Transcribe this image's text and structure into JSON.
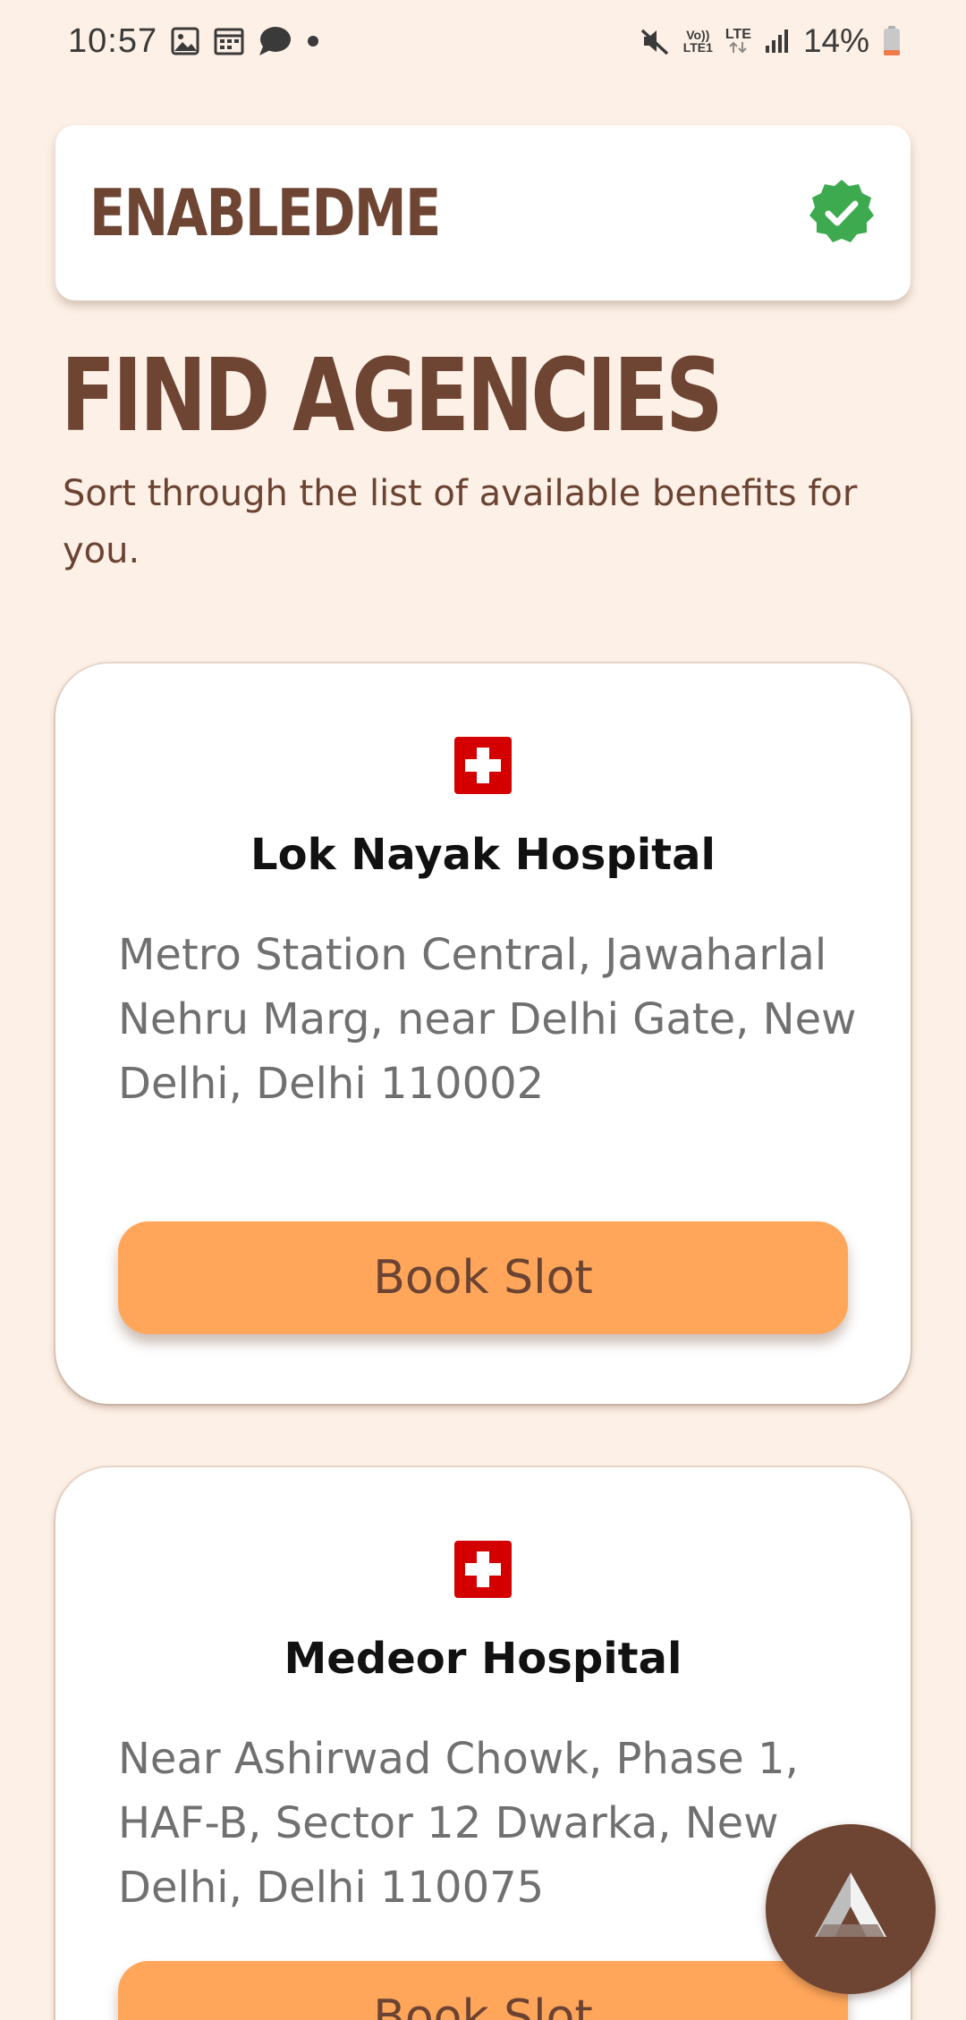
{
  "status_bar": {
    "time": "10:57",
    "notification_icons": [
      "gallery-icon",
      "calendar-icon",
      "chat-bubble-icon",
      "dot-icon"
    ],
    "network_label_top": "Vo))",
    "network_label_bottom": "LTE1",
    "lte_label": "LTE",
    "battery_percent": "14%",
    "icons": [
      "mute-icon",
      "signal-icon",
      "battery-icon"
    ]
  },
  "header": {
    "brand": "ENABLEDME",
    "verified_icon": "verified-badge-icon",
    "verified_color": "#3daa4f"
  },
  "page": {
    "title": "FIND AGENCIES",
    "subtitle": "Sort through the list of available benefits for you."
  },
  "agencies": [
    {
      "icon": "hospital-cross-icon",
      "name": "Lok Nayak Hospital",
      "address": "Metro Station Central, Jawaharlal Nehru Marg, near Delhi Gate, New Delhi, Delhi 110002",
      "button_label": "Book Slot"
    },
    {
      "icon": "hospital-cross-icon",
      "name": "Medeor Hospital",
      "address": "Near Ashirwad Chowk, Phase 1, HAF-B, Sector 12 Dwarka, New Delhi, Delhi 110075",
      "button_label": "Book Slot"
    }
  ],
  "fab": {
    "icon": "app-logo-icon"
  },
  "colors": {
    "background": "#fdf0e6",
    "brand_brown": "#6e4533",
    "button_orange": "#ffa65a",
    "hospital_red": "#d40000"
  }
}
